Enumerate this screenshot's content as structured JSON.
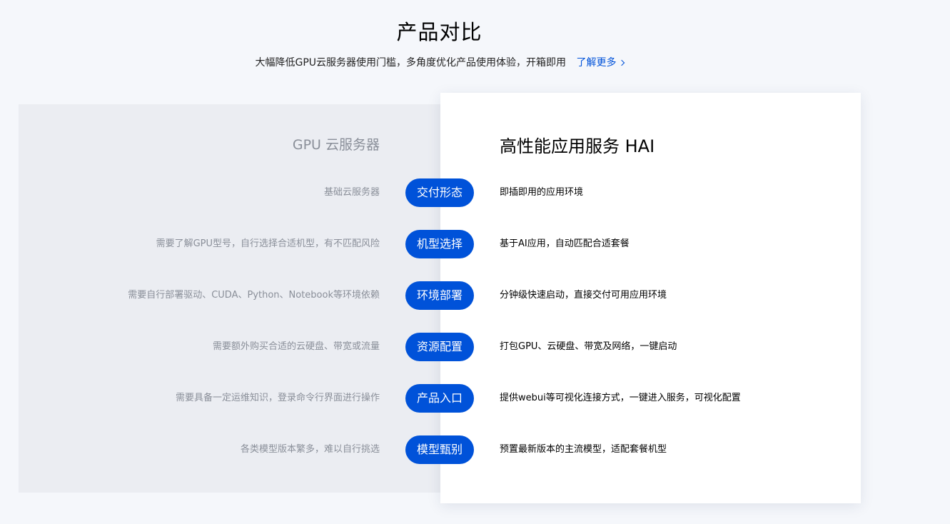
{
  "header": {
    "title": "产品对比",
    "subtitle": "大幅降低GPU云服务器使用门槛，多角度优化产品使用体验，开箱即用",
    "more_link": "了解更多"
  },
  "comparison": {
    "left_title": "GPU 云服务器",
    "right_title": "高性能应用服务 HAI",
    "rows": [
      {
        "label": "交付形态",
        "left": "基础云服务器",
        "right": "即插即用的应用环境"
      },
      {
        "label": "机型选择",
        "left": "需要了解GPU型号，自行选择合适机型，有不匹配风险",
        "right": "基于AI应用，自动匹配合适套餐"
      },
      {
        "label": "环境部署",
        "left": "需要自行部署驱动、CUDA、Python、Notebook等环境依赖",
        "right": "分钟级快速启动，直接交付可用应用环境"
      },
      {
        "label": "资源配置",
        "left": "需要额外购买合适的云硬盘、带宽或流量",
        "right": "打包GPU、云硬盘、带宽及网络，一键启动"
      },
      {
        "label": "产品入口",
        "left": "需要具备一定运维知识，登录命令行界面进行操作",
        "right": "提供webui等可视化连接方式，一键进入服务，可视化配置"
      },
      {
        "label": "模型甄别",
        "left": "各类模型版本繁多，难以自行挑选",
        "right": "预置最新版本的主流模型，适配套餐机型"
      }
    ]
  },
  "colors": {
    "accent": "#0052d9",
    "page_bg": "#f5f7fb",
    "left_panel_bg": "#ebedf2",
    "muted_text": "#8a8f99"
  },
  "icons": {
    "more_link_icon": "chevron-right-icon"
  }
}
